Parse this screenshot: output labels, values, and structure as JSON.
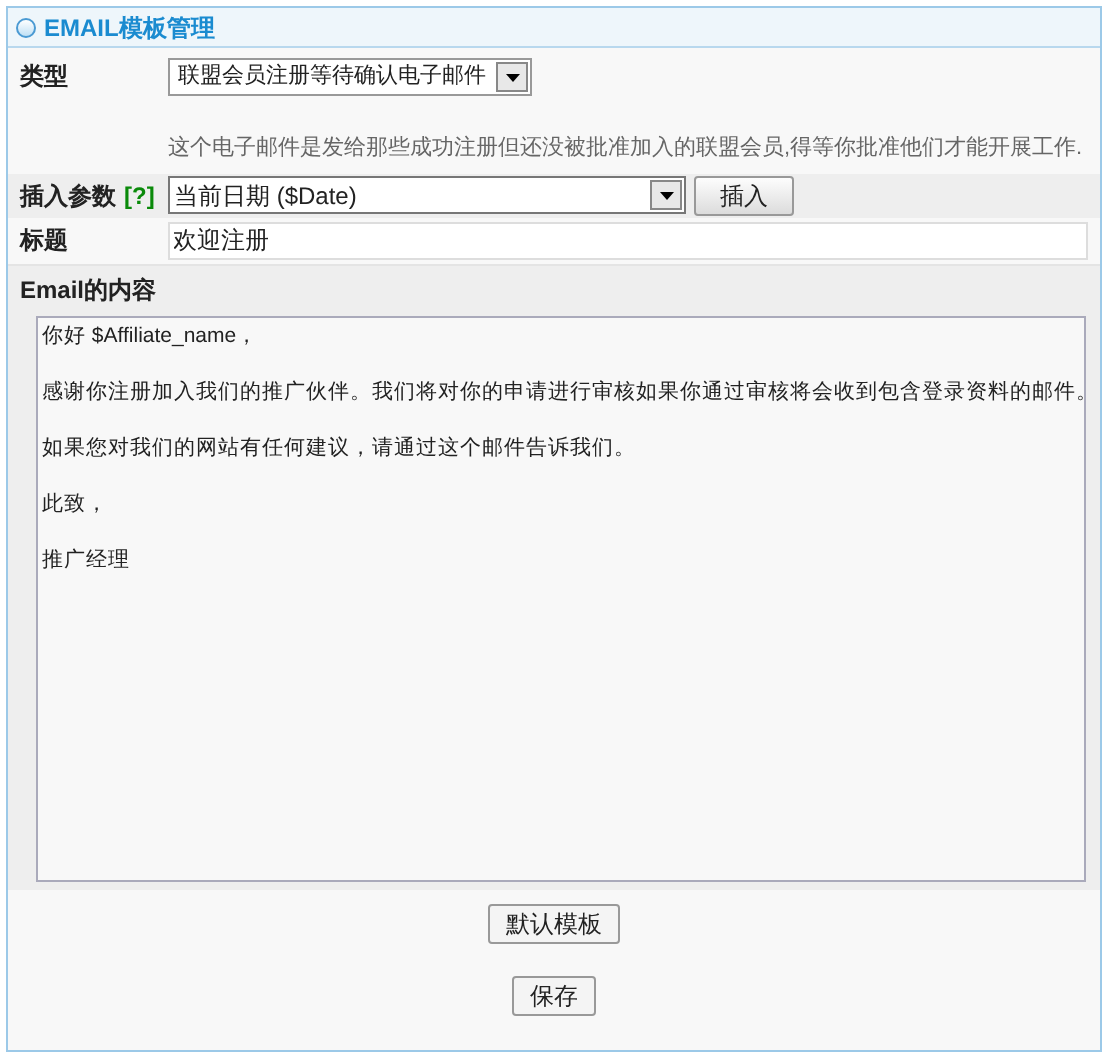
{
  "panel": {
    "title": "EMAIL模板管理"
  },
  "type_row": {
    "label": "类型",
    "select_value": "联盟会员注册等待确认电子邮件",
    "description": "这个电子邮件是发给那些成功注册但还没被批准加入的联盟会员,得等你批准他们才能开展工作."
  },
  "insert_row": {
    "label": "插入参数",
    "help": "[?]",
    "select_value": "当前日期 ($Date)",
    "button": "插入"
  },
  "subject_row": {
    "label": "标题",
    "value": "欢迎注册"
  },
  "body": {
    "label": "Email的内容",
    "lines": [
      {
        "text": "你好 $Affiliate_name，"
      },
      {
        "text": "感谢你注册加入我们的推广伙伴。我们将对你的申请进行审核如果你通过审核将会收到包含登录资料的邮件。"
      },
      {
        "text": "如果您对我们的网站有任何建议，请通过这个邮件告诉我们。"
      },
      {
        "text": "此致，"
      },
      {
        "text": "推广经理"
      }
    ]
  },
  "buttons": [
    {
      "label": "默认模板"
    },
    {
      "label": "保存"
    }
  ]
}
